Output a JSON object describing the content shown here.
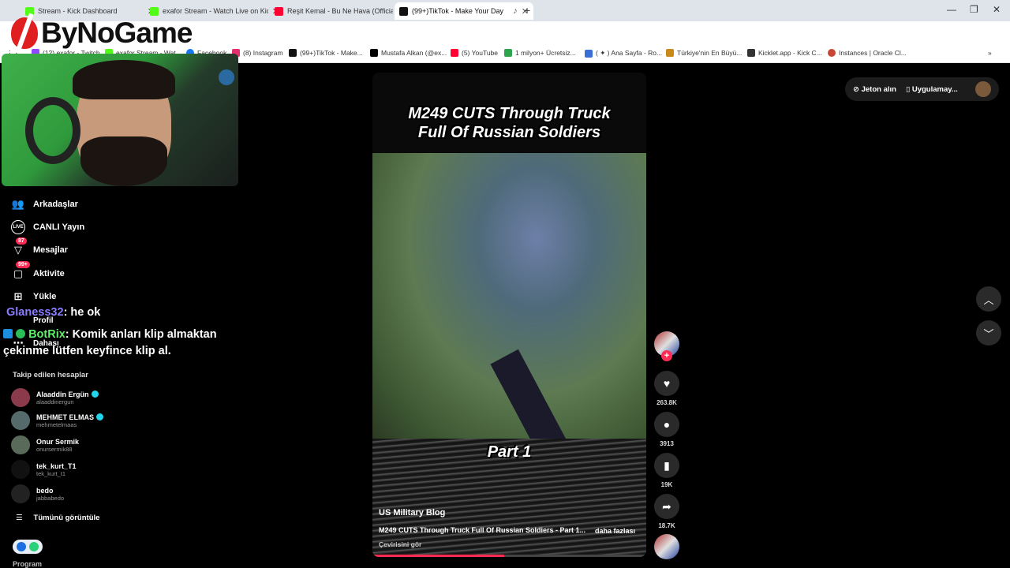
{
  "browser": {
    "tabs": [
      {
        "title": "Stream - Kick Dashboard",
        "color": "#53fc18"
      },
      {
        "title": "exafor Stream - Watch Live on Kick",
        "color": "#53fc18"
      },
      {
        "title": "Reşit Kemal - Bu Ne Hava (Official",
        "color": "#ff0033"
      },
      {
        "title": "(99+)TikTok - Make Your Day",
        "color": "#111111"
      }
    ],
    "new_tab": "+",
    "bookmarks": [
      {
        "label": "(12) exafor - Twitch",
        "color": "#9146ff"
      },
      {
        "label": "exafor Stream - Wat...",
        "color": "#53fc18"
      },
      {
        "label": "Facebook",
        "color": "#1877f2"
      },
      {
        "label": "(8) Instagram",
        "color": "#e1306c"
      },
      {
        "label": "(99+)TikTok - Make...",
        "color": "#111111"
      },
      {
        "label": "Mustafa Alkan (@ex...",
        "color": "#000000"
      },
      {
        "label": "(5) YouTube",
        "color": "#ff0033"
      },
      {
        "label": "1 milyon+ Ücretsiz...",
        "color": "#2ea44f"
      },
      {
        "label": "( ✦ ) Ana Sayfa - Ro...",
        "color": "#3b6fd8"
      },
      {
        "label": "Türkiye'nin En Büyü...",
        "color": "#c98a1c"
      },
      {
        "label": "Kicklet.app - Kick C...",
        "color": "#333333"
      },
      {
        "label": "Instances | Oracle Cl...",
        "color": "#c74634"
      }
    ]
  },
  "overlay": {
    "logo_text": "ByNoGame"
  },
  "sidebar": {
    "nav": [
      {
        "label": "Arkadaşlar",
        "icon": "friends-icon",
        "badge": ""
      },
      {
        "label": "CANLI Yayın",
        "icon": "live-icon",
        "badge": ""
      },
      {
        "label": "Mesajlar",
        "icon": "messages-icon",
        "badge": "87"
      },
      {
        "label": "Aktivite",
        "icon": "activity-icon",
        "badge": "99+"
      },
      {
        "label": "Yükle",
        "icon": "upload-icon",
        "badge": ""
      },
      {
        "label": "Profil",
        "icon": "profile-icon",
        "badge": ""
      },
      {
        "label": "Dahası",
        "icon": "more-icon",
        "badge": ""
      }
    ],
    "following_header": "Takip edilen hesaplar",
    "following": [
      {
        "name": "Alaaddin Ergün",
        "handle": "alaaddinergun",
        "verified": true
      },
      {
        "name": "MEHMET ELMAS",
        "handle": "mehmetelmaas",
        "verified": true
      },
      {
        "name": "Onur Sermik",
        "handle": "onursermik88",
        "verified": false
      },
      {
        "name": "tek_kurt_T1",
        "handle": "tek_kurt_t1",
        "verified": false
      },
      {
        "name": "bedo",
        "handle": "jabbabedo",
        "verified": false
      }
    ],
    "see_all": "Tümünü görüntüle",
    "program": "Program"
  },
  "chat": {
    "messages": [
      {
        "user": "Glaness32",
        "text": ": he ok"
      },
      {
        "user": "BotRix",
        "text": ": Komik anları klip almaktan çekinme lütfen keyfince klip al."
      }
    ]
  },
  "video": {
    "title_line1": "M249 CUTS Through Truck",
    "title_line2": "Full Of Russian Soldiers",
    "part": "Part 1",
    "author": "US Military Blog",
    "description": "M249 CUTS Through Truck Full Of Russian Soldiers - Part 1...",
    "more": "daha fazlası",
    "translate": "Çevirisini gör",
    "progress": 0.48
  },
  "actions": {
    "likes": "263.8K",
    "comments": "3913",
    "saves": "19K",
    "shares": "18.7K"
  },
  "topbar": {
    "coins": "Jeton alın",
    "app": "Uygulamay..."
  }
}
